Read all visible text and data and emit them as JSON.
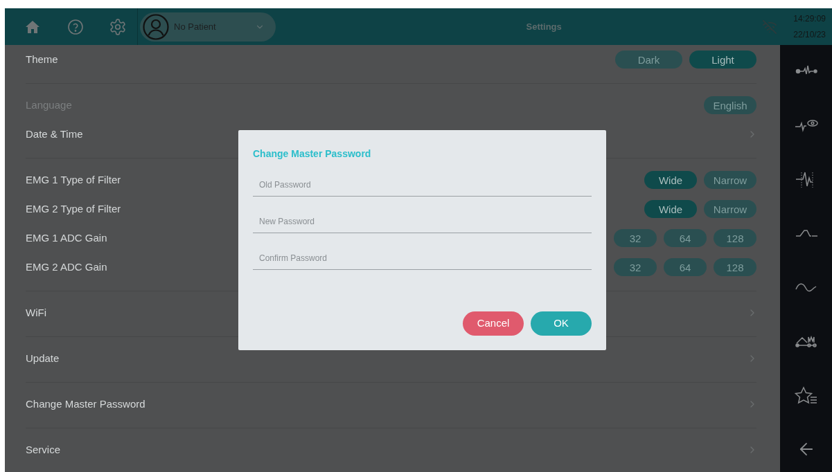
{
  "header": {
    "patient": "No Patient",
    "title": "Settings",
    "time": "14:29:09",
    "date": "22/10/23"
  },
  "sections": [
    {
      "rows": [
        {
          "kind": "options",
          "label": "Theme",
          "disabled": false,
          "options": [
            {
              "label": "Dark",
              "selected": false
            },
            {
              "label": "Light",
              "selected": true
            }
          ]
        }
      ]
    },
    {
      "rows": [
        {
          "kind": "options",
          "label": "Language",
          "disabled": true,
          "options": [
            {
              "label": "English",
              "selected": false
            }
          ]
        },
        {
          "kind": "link",
          "label": "Date & Time",
          "disabled": false
        }
      ]
    },
    {
      "rows": [
        {
          "kind": "options",
          "label": "EMG 1 Type of Filter",
          "disabled": false,
          "options": [
            {
              "label": "Wide",
              "selected": true
            },
            {
              "label": "Narrow",
              "selected": false
            }
          ]
        },
        {
          "kind": "options",
          "label": "EMG 2 Type of Filter",
          "disabled": false,
          "options": [
            {
              "label": "Wide",
              "selected": true
            },
            {
              "label": "Narrow",
              "selected": false
            }
          ]
        },
        {
          "kind": "options",
          "label": "EMG 1 ADC Gain",
          "disabled": false,
          "options": [
            {
              "label": "32",
              "selected": false
            },
            {
              "label": "64",
              "selected": false
            },
            {
              "label": "128",
              "selected": false
            }
          ]
        },
        {
          "kind": "options",
          "label": "EMG 2 ADC Gain",
          "disabled": false,
          "options": [
            {
              "label": "32",
              "selected": false
            },
            {
              "label": "64",
              "selected": false
            },
            {
              "label": "128",
              "selected": false
            }
          ]
        }
      ]
    },
    {
      "rows": [
        {
          "kind": "link",
          "label": "WiFi",
          "disabled": false
        }
      ]
    },
    {
      "rows": [
        {
          "kind": "link",
          "label": "Update",
          "disabled": false
        }
      ]
    },
    {
      "rows": [
        {
          "kind": "link",
          "label": "Change Master Password",
          "disabled": false
        }
      ]
    },
    {
      "rows": [
        {
          "kind": "link",
          "label": "Service",
          "disabled": false
        }
      ]
    }
  ],
  "modal": {
    "title": "Change Master Password",
    "fields": [
      {
        "placeholder": "Old Password"
      },
      {
        "placeholder": "New Password"
      },
      {
        "placeholder": "Confirm Password"
      }
    ],
    "buttons": [
      {
        "label": "Cancel",
        "kind": "cancel"
      },
      {
        "label": "OK",
        "kind": "ok"
      }
    ]
  }
}
